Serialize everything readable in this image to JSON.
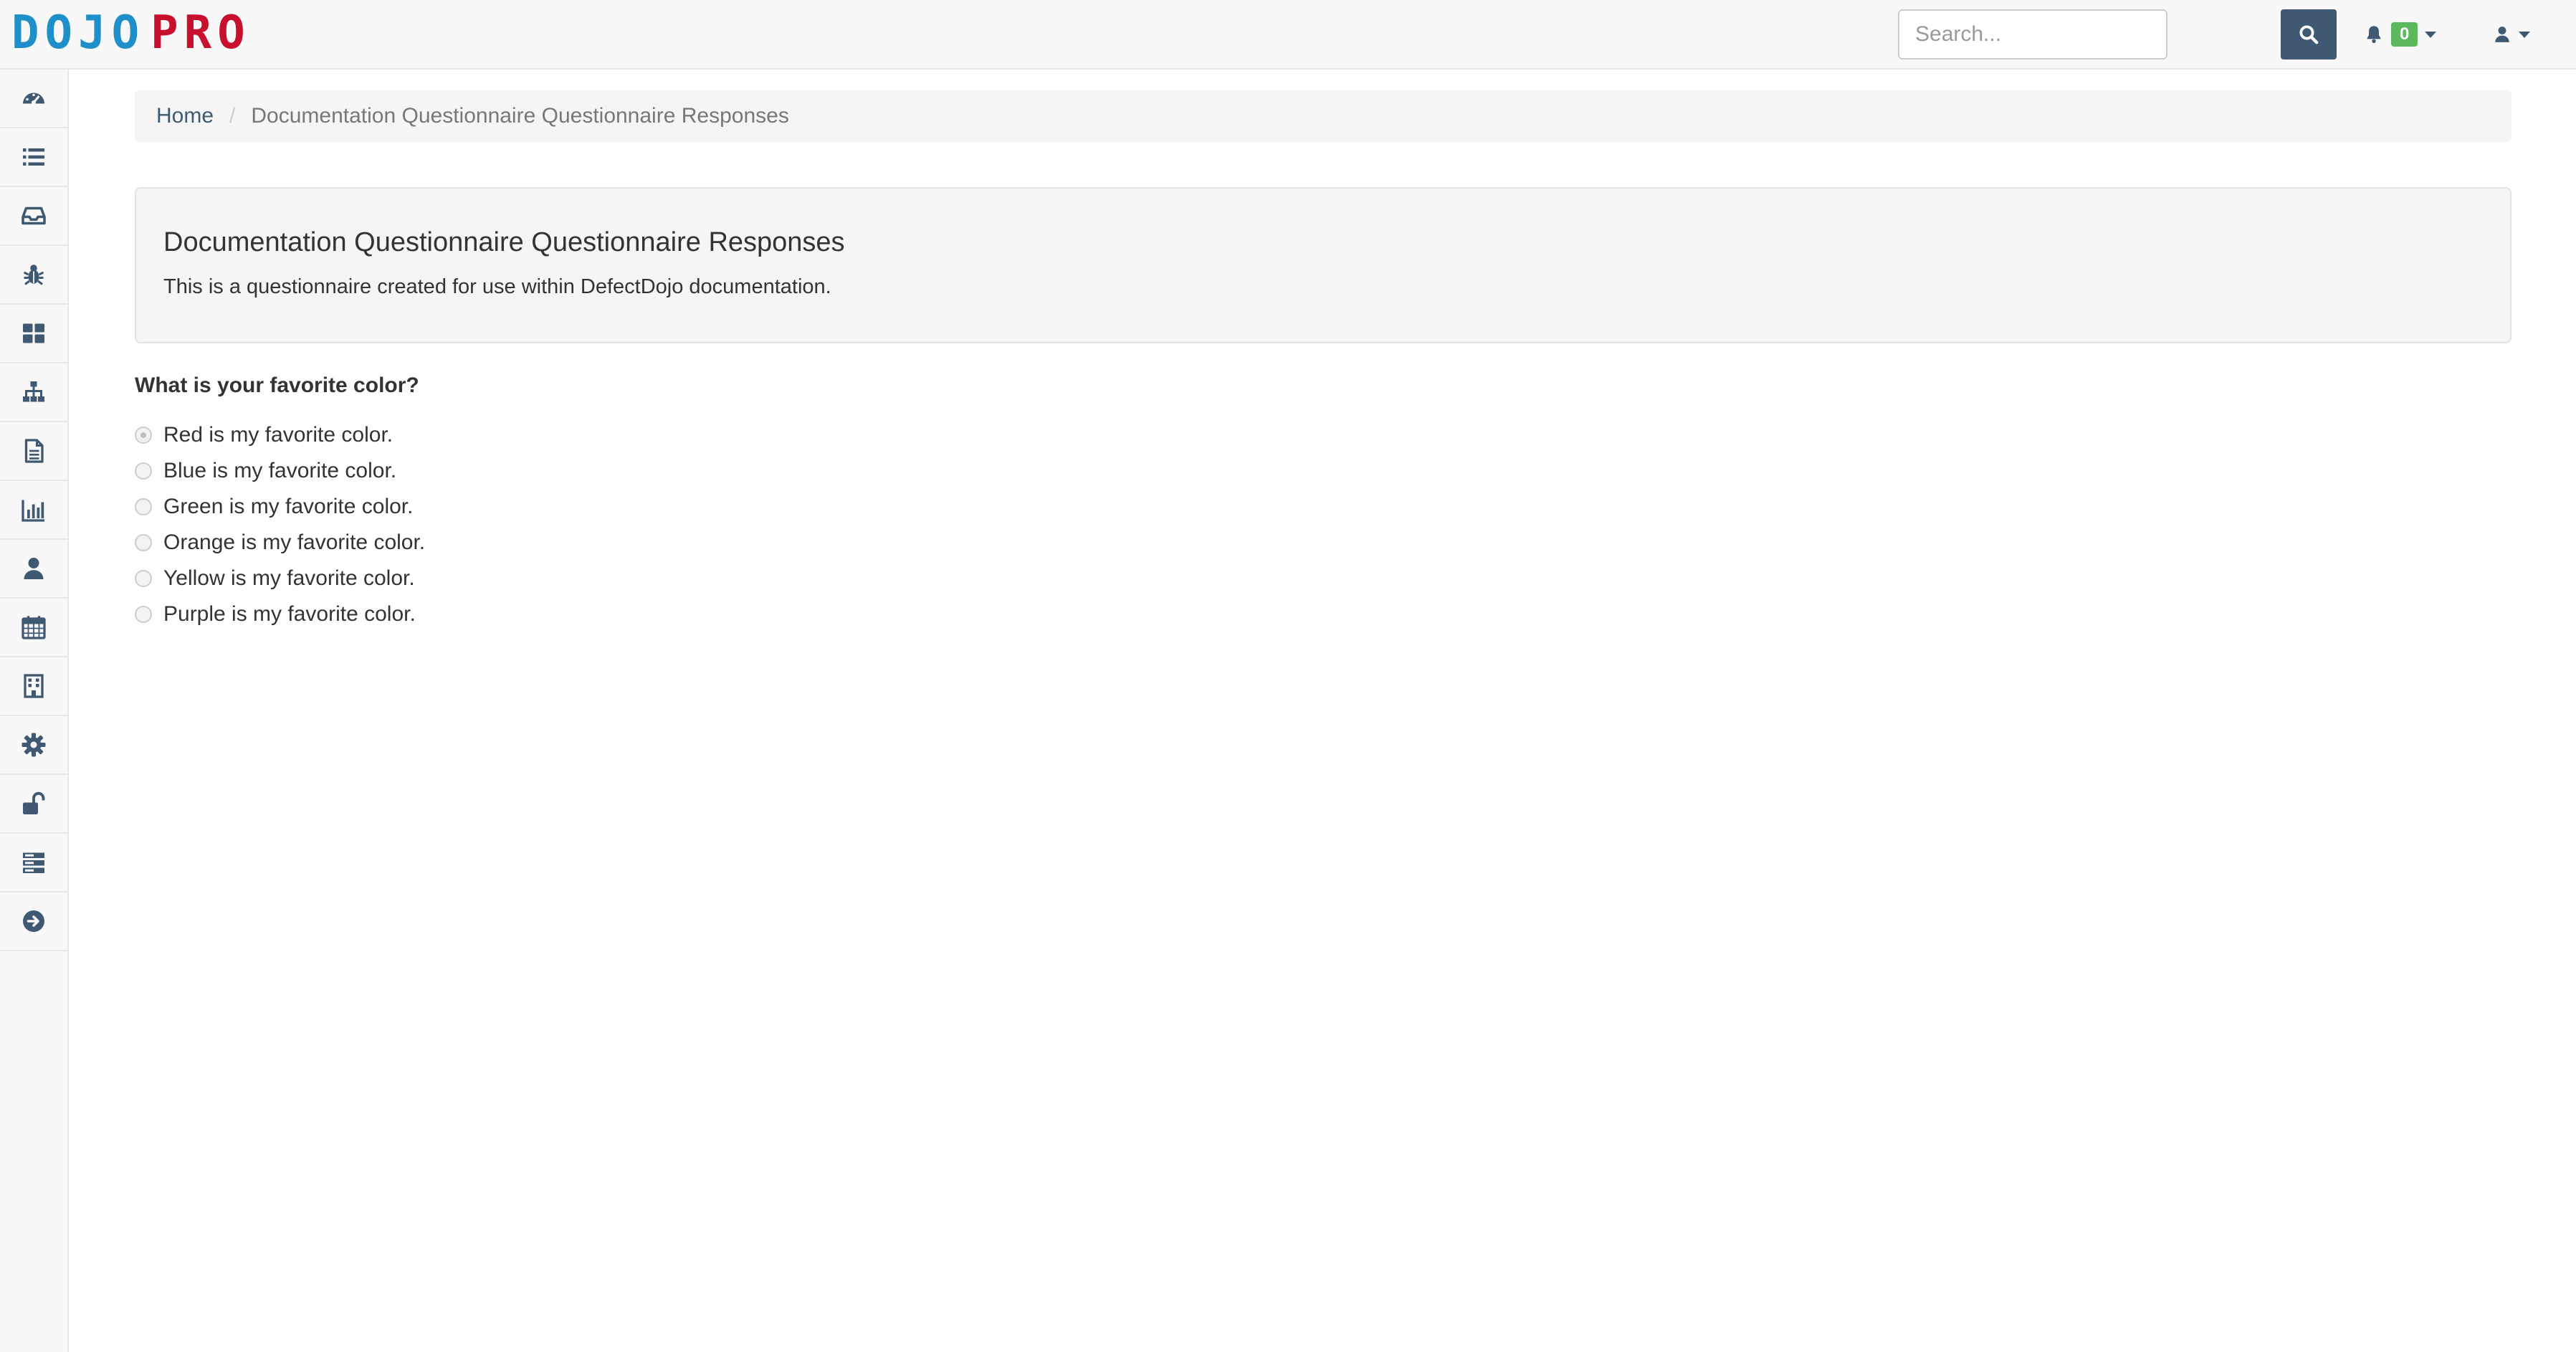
{
  "header": {
    "logo": {
      "part1": "DOJO",
      "part2": "PRO"
    },
    "search": {
      "placeholder": "Search...",
      "value": ""
    },
    "notifications": {
      "count": "0"
    }
  },
  "sidebar": {
    "items": [
      {
        "icon": "dashboard-icon"
      },
      {
        "icon": "list-icon"
      },
      {
        "icon": "inbox-icon"
      },
      {
        "icon": "bug-icon"
      },
      {
        "icon": "grid-icon"
      },
      {
        "icon": "sitemap-icon"
      },
      {
        "icon": "document-icon"
      },
      {
        "icon": "bar-chart-icon"
      },
      {
        "icon": "user-icon"
      },
      {
        "icon": "calendar-icon"
      },
      {
        "icon": "building-icon"
      },
      {
        "icon": "gear-icon"
      },
      {
        "icon": "unlock-icon"
      },
      {
        "icon": "server-icon"
      },
      {
        "icon": "arrow-circle-right-icon"
      }
    ]
  },
  "breadcrumb": {
    "home": "Home",
    "separator": "/",
    "current": "Documentation Questionnaire Questionnaire Responses"
  },
  "panel": {
    "title": "Documentation Questionnaire Questionnaire Responses",
    "description": "This is a questionnaire created for use within DefectDojo documentation."
  },
  "question": {
    "text": "What is your favorite color?",
    "selected_index": 0,
    "options": [
      "Red is my favorite color.",
      "Blue is my favorite color.",
      "Green is my favorite color.",
      "Orange is my favorite color.",
      "Yellow is my favorite color.",
      "Purple is my favorite color."
    ]
  },
  "colors": {
    "accent": "#3f5973",
    "badge": "#5cb85c",
    "logo_blue": "#1f8fc9",
    "logo_red": "#c8102e",
    "bar_bg": "#f8f8f8"
  }
}
